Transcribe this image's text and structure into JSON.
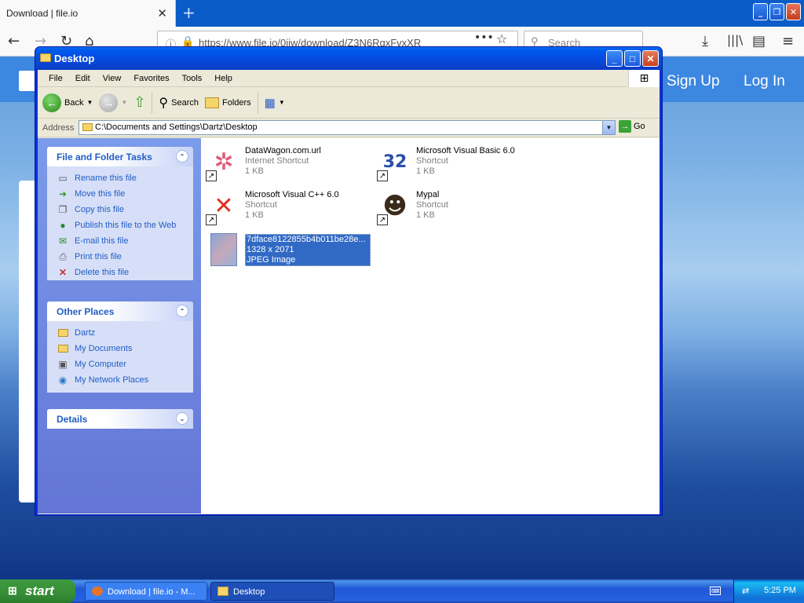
{
  "browser": {
    "tab_title": "Download | file.io",
    "close_tab": "✕",
    "new_tab": "+",
    "url": "https://www.file.io/0jiw/download/Z3N6RqxFvxXR",
    "search_placeholder": "Search"
  },
  "page": {
    "signup": "Sign Up",
    "login": "Log In"
  },
  "window": {
    "title": "Desktop",
    "menu": [
      "File",
      "Edit",
      "View",
      "Favorites",
      "Tools",
      "Help"
    ],
    "toolbar": {
      "back": "Back",
      "search": "Search",
      "folders": "Folders"
    },
    "address_label": "Address",
    "address": "C:\\Documents and Settings\\Dartz\\Desktop",
    "go": "Go"
  },
  "taskpane": {
    "file_tasks": {
      "title": "File and Folder Tasks",
      "items": [
        "Rename this file",
        "Move this file",
        "Copy this file",
        "Publish this file to the Web",
        "E-mail this file",
        "Print this file",
        "Delete this file"
      ]
    },
    "other_places": {
      "title": "Other Places",
      "items": [
        "Dartz",
        "My Documents",
        "My Computer",
        "My Network Places"
      ]
    },
    "details": {
      "title": "Details"
    }
  },
  "files": [
    {
      "name": "DataWagon.com.url",
      "type": "Internet Shortcut",
      "size": "1 KB",
      "icon": "internet-shortcut-icon"
    },
    {
      "name": "Microsoft Visual Basic 6.0",
      "type": "Shortcut",
      "size": "1 KB",
      "icon": "visual-basic-icon"
    },
    {
      "name": "Microsoft Visual C++ 6.0",
      "type": "Shortcut",
      "size": "1 KB",
      "icon": "visual-cpp-icon"
    },
    {
      "name": "Mypal",
      "type": "Shortcut",
      "size": "1 KB",
      "icon": "mypal-icon"
    },
    {
      "name": "7dface8122855b4b011be28e...",
      "type": "1328 x 2071",
      "size": "JPEG Image",
      "icon": "jpeg-image-icon",
      "selected": true
    }
  ],
  "taskbar": {
    "start": "start",
    "tasks": [
      "Download | file.io - M...",
      "Desktop"
    ],
    "clock": "5:25 PM"
  },
  "colors": {
    "xp_blue": "#0831d9",
    "task_link": "#215dc6",
    "selection": "#316ac5"
  }
}
